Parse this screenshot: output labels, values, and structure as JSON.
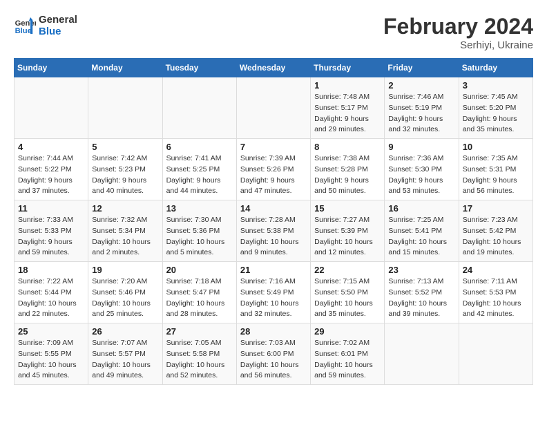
{
  "header": {
    "logo_line1": "General",
    "logo_line2": "Blue",
    "main_title": "February 2024",
    "sub_title": "Serhiyi, Ukraine"
  },
  "calendar": {
    "days_of_week": [
      "Sunday",
      "Monday",
      "Tuesday",
      "Wednesday",
      "Thursday",
      "Friday",
      "Saturday"
    ],
    "weeks": [
      [
        {
          "day": "",
          "detail": ""
        },
        {
          "day": "",
          "detail": ""
        },
        {
          "day": "",
          "detail": ""
        },
        {
          "day": "",
          "detail": ""
        },
        {
          "day": "1",
          "detail": "Sunrise: 7:48 AM\nSunset: 5:17 PM\nDaylight: 9 hours\nand 29 minutes."
        },
        {
          "day": "2",
          "detail": "Sunrise: 7:46 AM\nSunset: 5:19 PM\nDaylight: 9 hours\nand 32 minutes."
        },
        {
          "day": "3",
          "detail": "Sunrise: 7:45 AM\nSunset: 5:20 PM\nDaylight: 9 hours\nand 35 minutes."
        }
      ],
      [
        {
          "day": "4",
          "detail": "Sunrise: 7:44 AM\nSunset: 5:22 PM\nDaylight: 9 hours\nand 37 minutes."
        },
        {
          "day": "5",
          "detail": "Sunrise: 7:42 AM\nSunset: 5:23 PM\nDaylight: 9 hours\nand 40 minutes."
        },
        {
          "day": "6",
          "detail": "Sunrise: 7:41 AM\nSunset: 5:25 PM\nDaylight: 9 hours\nand 44 minutes."
        },
        {
          "day": "7",
          "detail": "Sunrise: 7:39 AM\nSunset: 5:26 PM\nDaylight: 9 hours\nand 47 minutes."
        },
        {
          "day": "8",
          "detail": "Sunrise: 7:38 AM\nSunset: 5:28 PM\nDaylight: 9 hours\nand 50 minutes."
        },
        {
          "day": "9",
          "detail": "Sunrise: 7:36 AM\nSunset: 5:30 PM\nDaylight: 9 hours\nand 53 minutes."
        },
        {
          "day": "10",
          "detail": "Sunrise: 7:35 AM\nSunset: 5:31 PM\nDaylight: 9 hours\nand 56 minutes."
        }
      ],
      [
        {
          "day": "11",
          "detail": "Sunrise: 7:33 AM\nSunset: 5:33 PM\nDaylight: 9 hours\nand 59 minutes."
        },
        {
          "day": "12",
          "detail": "Sunrise: 7:32 AM\nSunset: 5:34 PM\nDaylight: 10 hours\nand 2 minutes."
        },
        {
          "day": "13",
          "detail": "Sunrise: 7:30 AM\nSunset: 5:36 PM\nDaylight: 10 hours\nand 5 minutes."
        },
        {
          "day": "14",
          "detail": "Sunrise: 7:28 AM\nSunset: 5:38 PM\nDaylight: 10 hours\nand 9 minutes."
        },
        {
          "day": "15",
          "detail": "Sunrise: 7:27 AM\nSunset: 5:39 PM\nDaylight: 10 hours\nand 12 minutes."
        },
        {
          "day": "16",
          "detail": "Sunrise: 7:25 AM\nSunset: 5:41 PM\nDaylight: 10 hours\nand 15 minutes."
        },
        {
          "day": "17",
          "detail": "Sunrise: 7:23 AM\nSunset: 5:42 PM\nDaylight: 10 hours\nand 19 minutes."
        }
      ],
      [
        {
          "day": "18",
          "detail": "Sunrise: 7:22 AM\nSunset: 5:44 PM\nDaylight: 10 hours\nand 22 minutes."
        },
        {
          "day": "19",
          "detail": "Sunrise: 7:20 AM\nSunset: 5:46 PM\nDaylight: 10 hours\nand 25 minutes."
        },
        {
          "day": "20",
          "detail": "Sunrise: 7:18 AM\nSunset: 5:47 PM\nDaylight: 10 hours\nand 28 minutes."
        },
        {
          "day": "21",
          "detail": "Sunrise: 7:16 AM\nSunset: 5:49 PM\nDaylight: 10 hours\nand 32 minutes."
        },
        {
          "day": "22",
          "detail": "Sunrise: 7:15 AM\nSunset: 5:50 PM\nDaylight: 10 hours\nand 35 minutes."
        },
        {
          "day": "23",
          "detail": "Sunrise: 7:13 AM\nSunset: 5:52 PM\nDaylight: 10 hours\nand 39 minutes."
        },
        {
          "day": "24",
          "detail": "Sunrise: 7:11 AM\nSunset: 5:53 PM\nDaylight: 10 hours\nand 42 minutes."
        }
      ],
      [
        {
          "day": "25",
          "detail": "Sunrise: 7:09 AM\nSunset: 5:55 PM\nDaylight: 10 hours\nand 45 minutes."
        },
        {
          "day": "26",
          "detail": "Sunrise: 7:07 AM\nSunset: 5:57 PM\nDaylight: 10 hours\nand 49 minutes."
        },
        {
          "day": "27",
          "detail": "Sunrise: 7:05 AM\nSunset: 5:58 PM\nDaylight: 10 hours\nand 52 minutes."
        },
        {
          "day": "28",
          "detail": "Sunrise: 7:03 AM\nSunset: 6:00 PM\nDaylight: 10 hours\nand 56 minutes."
        },
        {
          "day": "29",
          "detail": "Sunrise: 7:02 AM\nSunset: 6:01 PM\nDaylight: 10 hours\nand 59 minutes."
        },
        {
          "day": "",
          "detail": ""
        },
        {
          "day": "",
          "detail": ""
        }
      ]
    ]
  }
}
